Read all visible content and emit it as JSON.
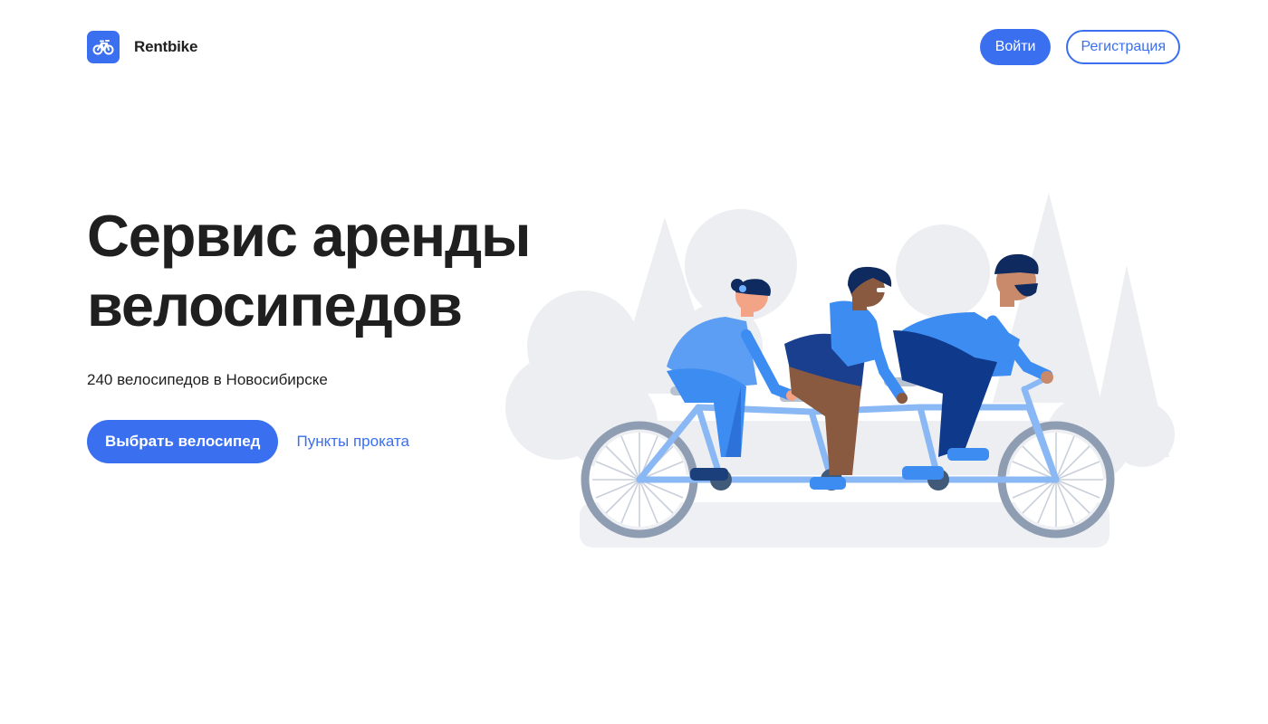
{
  "header": {
    "brand_name": "Rentbike",
    "login_label": "Войти",
    "register_label": "Регистрация"
  },
  "hero": {
    "title_line1": "Сервис аренды",
    "title_line2": "велосипедов",
    "subtitle": "240 велосипедов в Новосибирске",
    "primary_cta": "Выбрать велосипед",
    "secondary_link": "Пункты проката"
  },
  "icons": {
    "logo": "bicycle-icon"
  },
  "colors": {
    "accent": "#3a6ff0",
    "text": "#1f1f1f",
    "illustration_gray": "#e6e7ea",
    "rider_blue": "#3d8cf2",
    "rider_navy": "#0f3a8c"
  }
}
